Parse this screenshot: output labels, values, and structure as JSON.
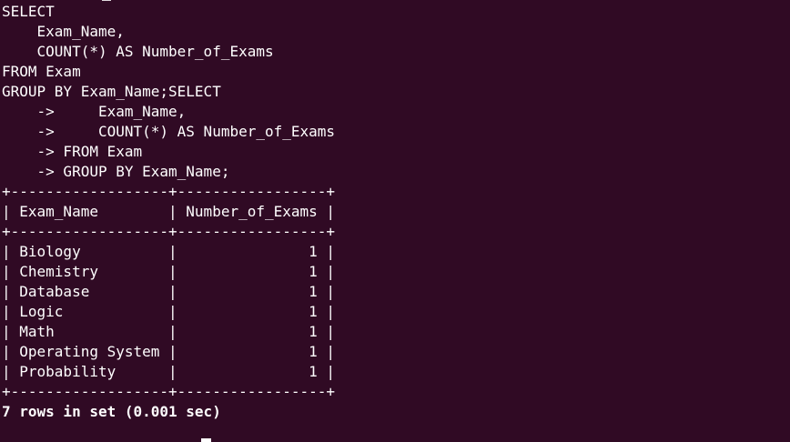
{
  "terminal": {
    "query_lines": [
      "SELECT",
      "    Exam_Name,",
      "    COUNT(*) AS Number_of_Exams",
      "FROM Exam",
      "GROUP BY Exam_Name;SELECT",
      "    ->     Exam_Name,",
      "    ->     COUNT(*) AS Number_of_Exams",
      "    -> FROM Exam",
      "    -> GROUP BY Exam_Name;"
    ],
    "table": {
      "border": "+------------------+-----------------+",
      "header": "| Exam_Name        | Number_of_Exams |",
      "rows": [
        "| Biology          |               1 |",
        "| Chemistry        |               1 |",
        "| Database         |               1 |",
        "| Logic            |               1 |",
        "| Math             |               1 |",
        "| Operating System |               1 |",
        "| Probability      |               1 |"
      ]
    },
    "status": "7 rows in set (0.001 sec)"
  },
  "colors": {
    "background": "#300a24",
    "text": "#ffffff"
  }
}
